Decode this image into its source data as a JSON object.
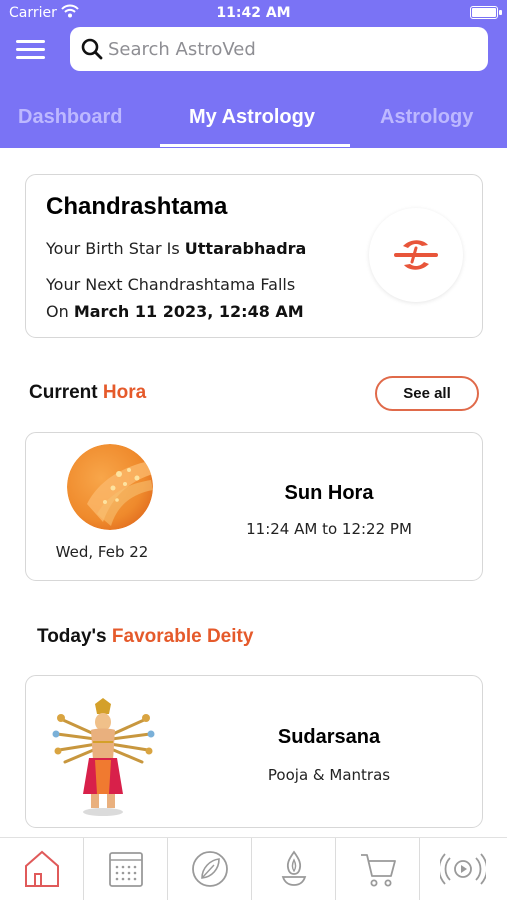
{
  "status_bar": {
    "carrier": "Carrier",
    "time": "11:42 AM"
  },
  "search": {
    "placeholder": "Search AstroVed"
  },
  "tabs": [
    {
      "label": "Dashboard",
      "active": false
    },
    {
      "label": "My Astrology",
      "active": true
    },
    {
      "label": "Astrology",
      "active": false
    }
  ],
  "chandrashtama": {
    "title": "Chandrashtama",
    "birth_star_prefix": "Your Birth Star Is ",
    "birth_star": "Uttarabhadra",
    "next_line1": "Your Next Chandrashtama Falls",
    "next_prefix": "On ",
    "next_date": "March 11 2023, 12:48 AM"
  },
  "current_hora": {
    "title_plain": "Current ",
    "title_accent": "Hora",
    "see_all_label": "See all",
    "date": "Wed, Feb 22",
    "name": "Sun Hora",
    "time_range": "11:24 AM to 12:22 PM"
  },
  "favorable_deity": {
    "title_plain": "Today's ",
    "title_accent": "Favorable Deity",
    "name": "Sudarsana",
    "subtitle": "Pooja & Mantras"
  },
  "bottom_nav": [
    {
      "icon": "home-icon",
      "active": true
    },
    {
      "icon": "calendar-icon",
      "active": false
    },
    {
      "icon": "leaf-icon",
      "active": false
    },
    {
      "icon": "lamp-icon",
      "active": false
    },
    {
      "icon": "cart-icon",
      "active": false
    },
    {
      "icon": "live-broadcast-icon",
      "active": false
    }
  ],
  "colors": {
    "header": "#7a73f5",
    "accent": "#e55a2b",
    "active_nav": "#e05a5a",
    "inactive_nav": "#9a9a9a"
  }
}
